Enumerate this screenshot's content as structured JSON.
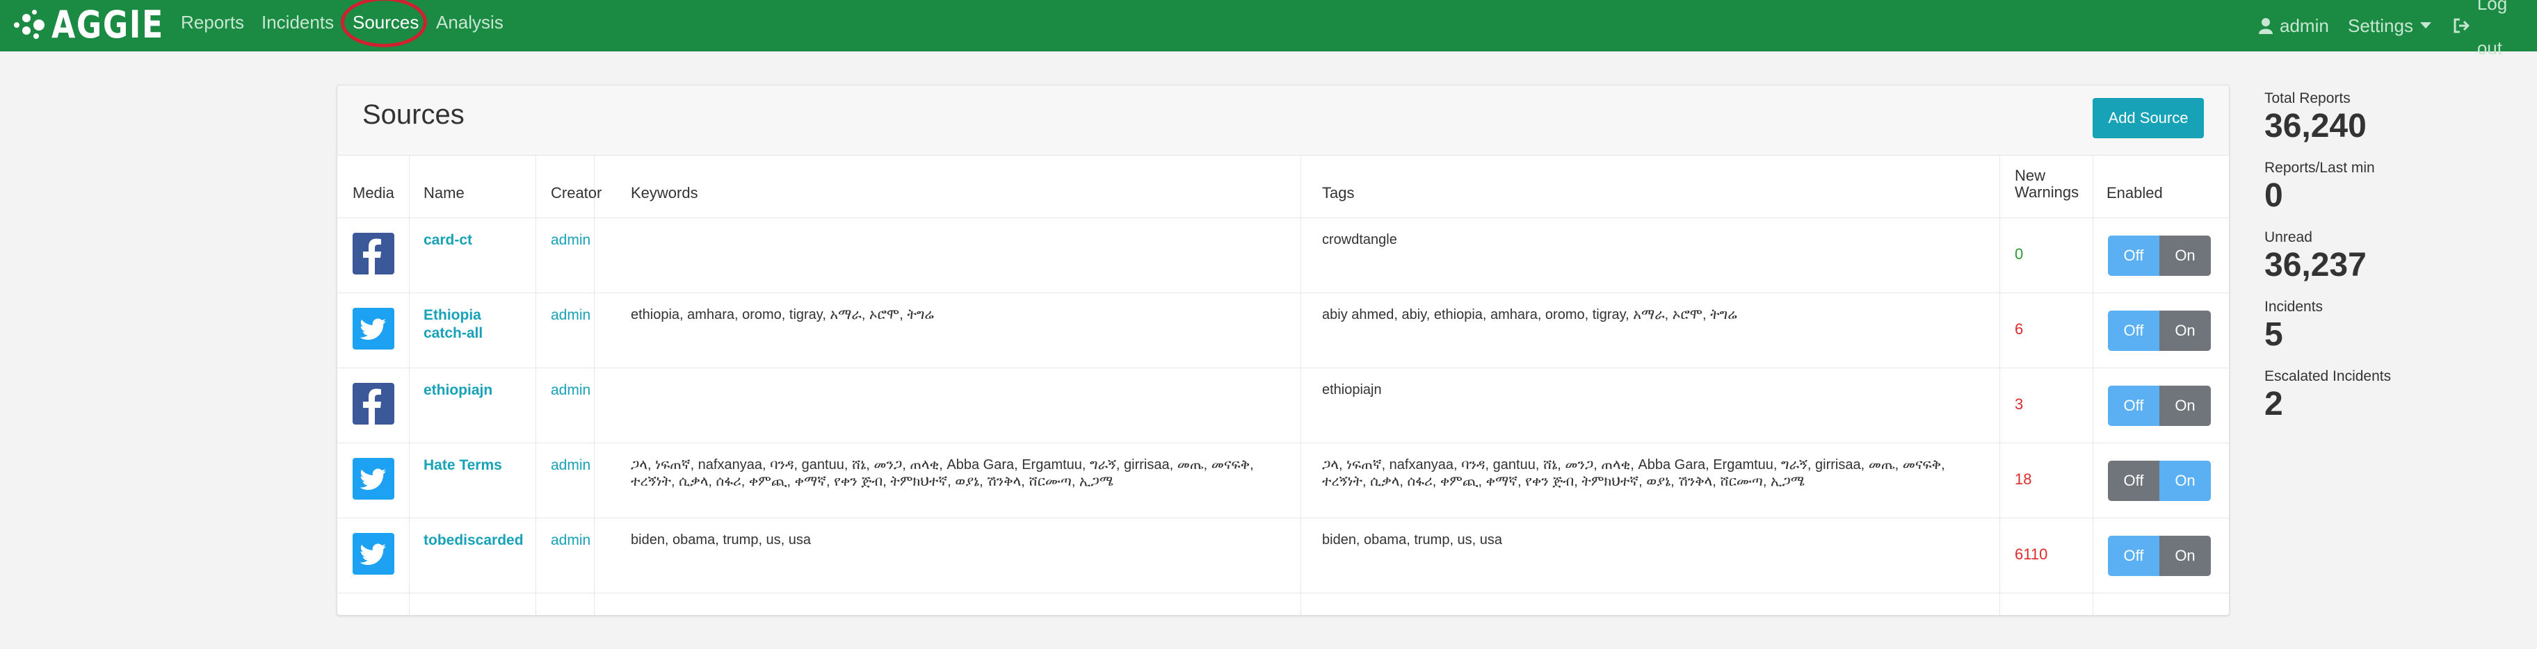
{
  "navbar": {
    "brand": "AGGIE",
    "links": [
      "Reports",
      "Incidents",
      "Sources",
      "Analysis"
    ],
    "active": "Sources",
    "user": "admin",
    "settings": "Settings",
    "logout": "Log out"
  },
  "page": {
    "title": "Sources",
    "add_button": "Add Source"
  },
  "table": {
    "headers": {
      "media": "Media",
      "name": "Name",
      "creator": "Creator",
      "keywords": "Keywords",
      "tags": "Tags",
      "new_warnings_1": "New",
      "new_warnings_2": "Warnings",
      "enabled": "Enabled"
    },
    "toggle_off": "Off",
    "toggle_on": "On",
    "rows": [
      {
        "media": "facebook",
        "name1": "card-ct",
        "name2": "",
        "creator": "admin",
        "keywords1": "",
        "keywords2": "",
        "tags1": "crowdtangle",
        "tags2": "",
        "warnings": "0",
        "enabled": false
      },
      {
        "media": "twitter",
        "name1": "Ethiopia",
        "name2": "catch-all",
        "creator": "admin",
        "keywords1": "ethiopia, amhara, oromo, tigray, አማራ, ኦሮሞ, ትግሬ",
        "keywords2": "",
        "tags1": "abiy ahmed, abiy, ethiopia, amhara, oromo, tigray, አማራ, ኦሮሞ, ትግሬ",
        "tags2": "",
        "warnings": "6",
        "enabled": false
      },
      {
        "media": "facebook",
        "name1": "ethiopiajn",
        "name2": "",
        "creator": "admin",
        "keywords1": "",
        "keywords2": "",
        "tags1": "ethiopiajn",
        "tags2": "",
        "warnings": "3",
        "enabled": false
      },
      {
        "media": "twitter",
        "name1": "Hate Terms",
        "name2": "",
        "creator": "admin",
        "keywords1": "ጋላ, ነፍጠኛ, nafxanyaa, ባንዳ, gantuu, ሸኔ, መንጋ, ጠላቂ, Abba Gara, Ergamtuu, ግራኝ, girrisaa, መጤ, መናፍቅ,",
        "keywords2": "ተረኝነት, ሲቃላ, ሰፋሪ, ቀምጪ, ቀማኛ, የቀን ጅብ, ትምክህተኛ, ወያኔ, ሽንቅላ, ሸርሙጣ, ኢጋሜ",
        "tags1": "ጋላ, ነፍጠኛ, nafxanyaa, ባንዳ, gantuu, ሸኔ, መንጋ, ጠላቂ, Abba Gara, Ergamtuu, ግራኝ, girrisaa, መጤ, መናፍቅ,",
        "tags2": "ተረኝነት, ሲቃላ, ሰፋሪ, ቀምጪ, ቀማኛ, የቀን ጅብ, ትምክህተኛ, ወያኔ, ሽንቅላ, ሸርሙጣ, ኢጋሜ",
        "warnings": "18",
        "enabled": true
      },
      {
        "media": "twitter",
        "name1": "tobediscarded",
        "name2": "",
        "creator": "admin",
        "keywords1": "biden, obama, trump, us, usa",
        "keywords2": "",
        "tags1": "biden, obama, trump, us, usa",
        "tags2": "",
        "warnings": "6110",
        "enabled": false
      }
    ]
  },
  "stats": {
    "total_reports_label": "Total Reports",
    "total_reports": "36,240",
    "reports_last_min_label": "Reports/Last min",
    "reports_last_min": "0",
    "unread_label": "Unread",
    "unread": "36,237",
    "incidents_label": "Incidents",
    "incidents": "5",
    "escalated_label": "Escalated Incidents",
    "escalated": "2"
  },
  "colors": {
    "navbar": "#1b8a43",
    "accent": "#17a2b8",
    "toggle_light": "#5ab0f2",
    "toggle_dark": "#6f757b",
    "warn_red": "#e02b2b",
    "warn_green": "#2e9d2e"
  }
}
